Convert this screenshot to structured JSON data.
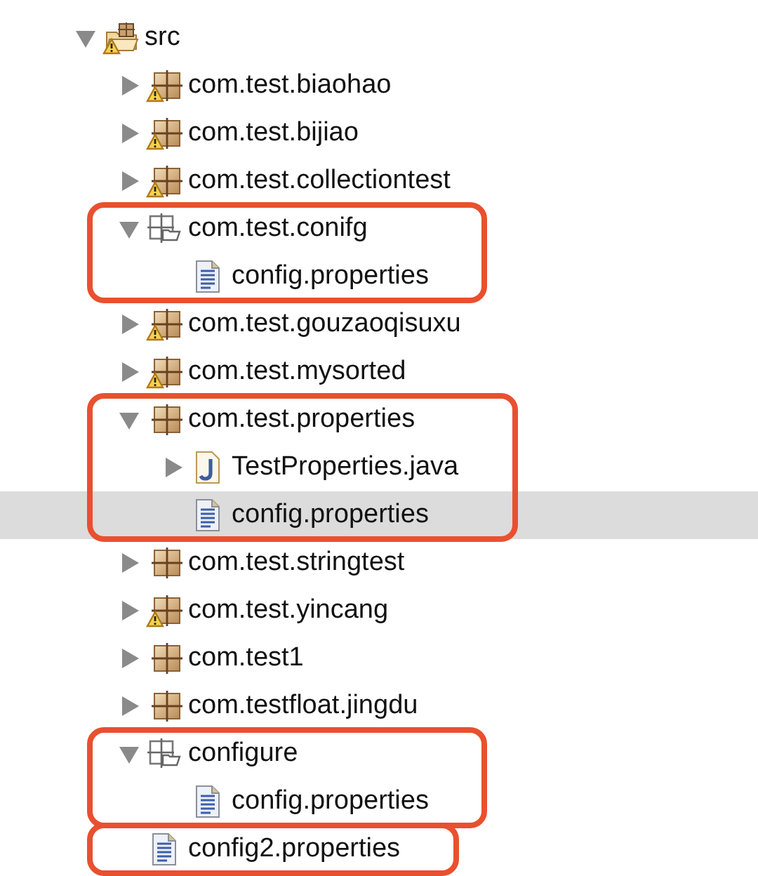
{
  "tree": [
    {
      "label": "src",
      "kind": "source-folder",
      "warning": true,
      "expanded": true,
      "selected": false,
      "highlighted": false,
      "children": [
        {
          "label": "com.test.biaohao",
          "kind": "package",
          "warning": true,
          "expanded": false,
          "selected": false,
          "highlighted": false
        },
        {
          "label": "com.test.bijiao",
          "kind": "package",
          "warning": true,
          "expanded": false,
          "selected": false,
          "highlighted": false
        },
        {
          "label": "com.test.collectiontest",
          "kind": "package",
          "warning": true,
          "expanded": false,
          "selected": false,
          "highlighted": false
        },
        {
          "label": "com.test.conifg",
          "kind": "empty-package",
          "warning": false,
          "expanded": true,
          "selected": false,
          "highlighted": true,
          "children": [
            {
              "label": "config.properties",
              "kind": "file",
              "warning": false,
              "selected": false,
              "highlighted": false
            }
          ]
        },
        {
          "label": "com.test.gouzaoqisuxu",
          "kind": "package",
          "warning": true,
          "expanded": false,
          "selected": false,
          "highlighted": false
        },
        {
          "label": "com.test.mysorted",
          "kind": "package",
          "warning": true,
          "expanded": false,
          "selected": false,
          "highlighted": false
        },
        {
          "label": "com.test.properties",
          "kind": "package",
          "warning": false,
          "expanded": true,
          "selected": false,
          "highlighted": true,
          "children": [
            {
              "label": "TestProperties.java",
              "kind": "java",
              "warning": false,
              "expanded": false,
              "selected": false,
              "highlighted": false
            },
            {
              "label": "config.properties",
              "kind": "file",
              "warning": false,
              "selected": true,
              "highlighted": false
            }
          ]
        },
        {
          "label": "com.test.stringtest",
          "kind": "package",
          "warning": false,
          "expanded": false,
          "selected": false,
          "highlighted": false
        },
        {
          "label": "com.test.yincang",
          "kind": "package",
          "warning": true,
          "expanded": false,
          "selected": false,
          "highlighted": false
        },
        {
          "label": "com.test1",
          "kind": "package",
          "warning": false,
          "expanded": false,
          "selected": false,
          "highlighted": false
        },
        {
          "label": "com.testfloat.jingdu",
          "kind": "package",
          "warning": false,
          "expanded": false,
          "selected": false,
          "highlighted": false
        },
        {
          "label": "configure",
          "kind": "empty-package",
          "warning": false,
          "expanded": true,
          "selected": false,
          "highlighted": true,
          "children": [
            {
              "label": "config.properties",
              "kind": "file",
              "warning": false,
              "selected": false,
              "highlighted": false
            }
          ]
        },
        {
          "label": "config2.properties",
          "kind": "file",
          "warning": false,
          "selected": false,
          "highlighted": true
        }
      ]
    }
  ]
}
